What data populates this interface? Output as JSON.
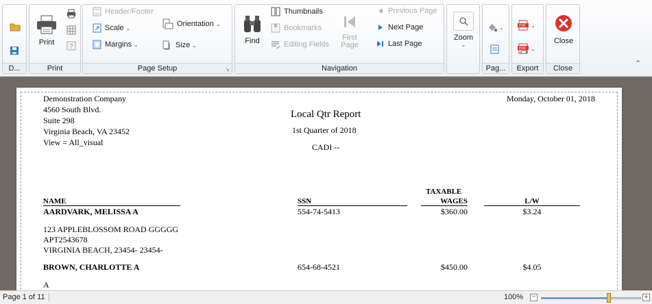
{
  "ribbon": {
    "document_group": {
      "label": "D..."
    },
    "print_group": {
      "label": "Print",
      "print_label": "Print"
    },
    "page_setup_group": {
      "label": "Page Setup",
      "header_footer": "Header/Footer",
      "scale": "Scale",
      "margins": "Margins",
      "orientation": "Orientation",
      "size": "Size"
    },
    "navigation_group": {
      "label": "Navigation",
      "find": "Find",
      "thumbnails": "Thumbnails",
      "bookmarks": "Bookmarks",
      "editing_fields": "Editing Fields",
      "first_page_line1": "First",
      "first_page_line2": "Page",
      "previous_page": "Previous Page",
      "next_page": "Next Page",
      "last_page": "Last Page"
    },
    "zoom_group": {
      "zoom": "Zoom"
    },
    "page_background_group": {
      "label": "Pag..."
    },
    "export_group": {
      "label": "Export"
    },
    "close_group": {
      "label": "Close",
      "close": "Close"
    }
  },
  "report": {
    "company": "Demonstration Company",
    "address1": "4560 South Blvd.",
    "address2": "Suite 298",
    "address3": "Virginia Beach, VA  23452",
    "view": "View = All_visual",
    "date": "Monday, October 01, 2018",
    "title": "Local Qtr Report",
    "quarter": "1st Quarter of 2018",
    "subtitle": "CADI --",
    "columns": {
      "name": "NAME",
      "ssn": "SSN",
      "taxable1": "TAXABLE",
      "taxable2": "WAGES",
      "lw": "L/W"
    },
    "rows": [
      {
        "name": "AARDVARK, MELISSA A",
        "ssn": "554-74-5413",
        "wages": "$360.00",
        "lw": "$3.24",
        "addr1": "123 APPLEBLOSSOM ROAD GGGGG",
        "addr2": "APT2543678",
        "addr3": "VIRGINIA BEACH, 23454-  23454-"
      },
      {
        "name": "BROWN, CHARLOTTE A",
        "ssn": "654-68-4521",
        "wages": "$450.00",
        "lw": "$4.05",
        "addr1": "A"
      }
    ]
  },
  "status": {
    "page_info": "Page 1 of 11",
    "zoom_level": "100%",
    "zoom_fraction": 0.68
  },
  "colors": {
    "accent_blue": "#2b79d0",
    "close_red": "#d9342b",
    "viewer_bg": "#6f6a66"
  }
}
